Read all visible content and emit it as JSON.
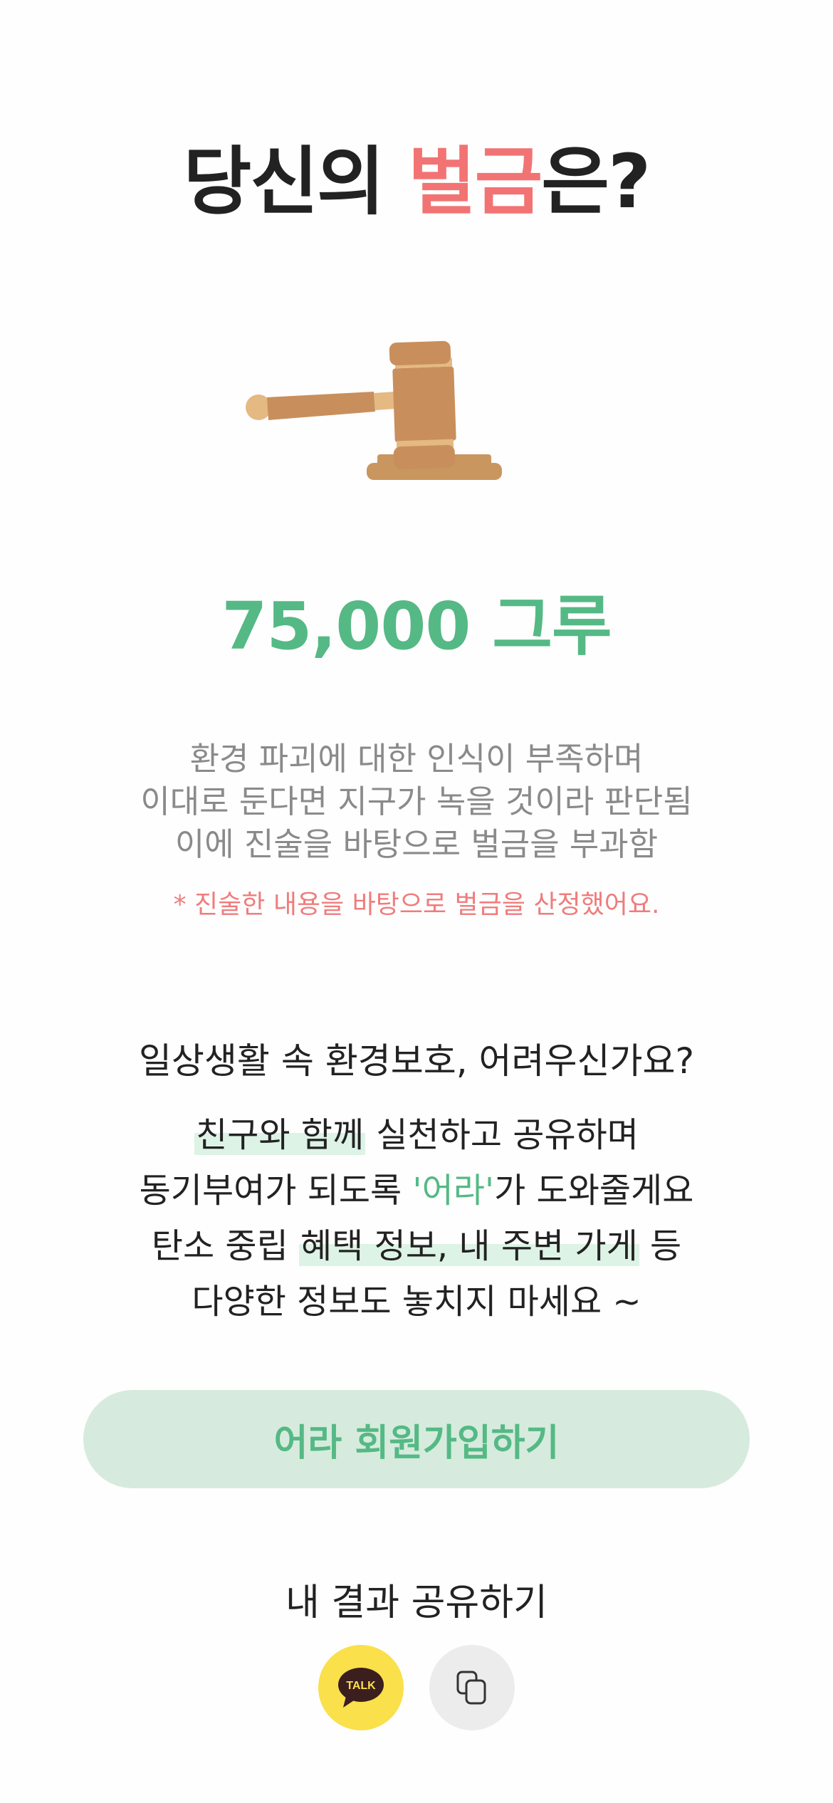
{
  "title": {
    "prefix": "당신의 ",
    "accent": "벌금",
    "suffix": "은?"
  },
  "amount": "75,000 그루",
  "reason": [
    "환경 파괴에 대한 인식이 부족하며",
    "이대로 둔다면 지구가 녹을 것이라 판단됨",
    "이에 진술을 바탕으로 벌금을 부과함"
  ],
  "note": "* 진술한 내용을 바탕으로 벌금을 산정했어요.",
  "promo": {
    "heading": "일상생활 속 환경보호, 어려우신가요?",
    "line1_highlight": "친구와 함께",
    "line1_rest": " 실천하고 공유하며",
    "line2_before": "동기부여가 되도록 ",
    "line2_brand": "'어라'",
    "line2_after": "가 도와줄게요",
    "line3_before": "탄소 중립 ",
    "line3_highlight": "혜택 정보, 내 주변 가게",
    "line3_after": " 등",
    "line4": "다양한 정보도 놓치지 마세요 ~"
  },
  "join_button": "어라 회원가입하기",
  "share": {
    "label": "내 결과 공유하기",
    "kakao_text": "TALK",
    "kakao_icon": "kakaotalk-icon",
    "copy_icon": "copy-icon"
  },
  "colors": {
    "accent_red": "#f27373",
    "brand_green": "#55b985",
    "button_bg": "#d6ebdd",
    "kakao_yellow": "#fae04a"
  }
}
